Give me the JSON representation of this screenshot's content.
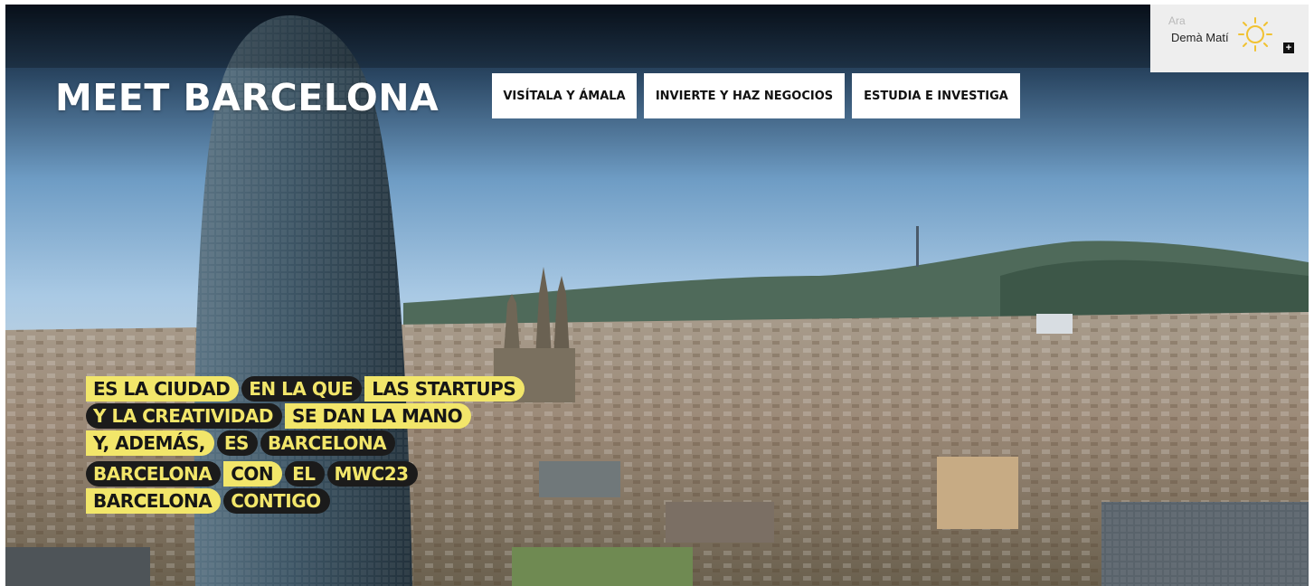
{
  "brand": {
    "title": "MEET BARCELONA"
  },
  "nav": {
    "items": [
      {
        "label": "VISÍTALA Y ÁMALA"
      },
      {
        "label": "INVIERTE Y HAZ NEGOCIOS"
      },
      {
        "label": "ESTUDIA E INVESTIGA"
      }
    ]
  },
  "weather": {
    "now_label": "Ara",
    "forecast_label": "Demà Matí",
    "icon": "sun-icon",
    "more_label": "+"
  },
  "taglines": {
    "block1": [
      [
        {
          "text": "ES LA CIUDAD",
          "style": "y"
        },
        {
          "text": "EN LA QUE",
          "style": "d"
        },
        {
          "text": "LAS STARTUPS",
          "style": "y"
        }
      ],
      [
        {
          "text": "Y LA CREATIVIDAD",
          "style": "d"
        },
        {
          "text": "SE DAN LA MANO",
          "style": "y"
        }
      ],
      [
        {
          "text": "Y, ADEMÁS,",
          "style": "y"
        },
        {
          "text": "ES",
          "style": "d"
        },
        {
          "text": "BARCELONA",
          "style": "d"
        }
      ]
    ],
    "block2": [
      [
        {
          "text": "BARCELONA",
          "style": "d"
        },
        {
          "text": "CON",
          "style": "y"
        },
        {
          "text": "EL",
          "style": "d"
        },
        {
          "text": "MWC23",
          "style": "d"
        }
      ],
      [
        {
          "text": "BARCELONA",
          "style": "y"
        },
        {
          "text": "CONTIGO",
          "style": "d"
        }
      ]
    ]
  },
  "colors": {
    "accent_yellow": "#f2e66a",
    "chip_dark": "#1b1b1b",
    "sky_top": "#0d1a2a",
    "sky_mid": "#8fb6d9"
  }
}
